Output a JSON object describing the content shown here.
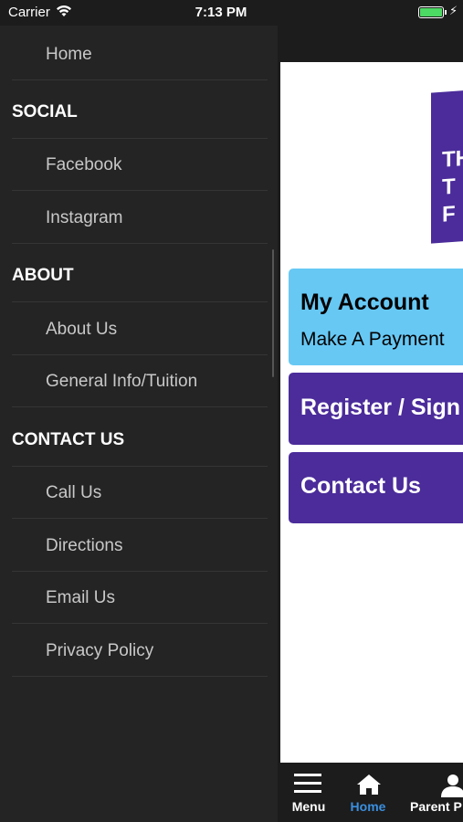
{
  "status_bar": {
    "carrier": "Carrier",
    "time": "7:13 PM",
    "battery_color": "#4cd964"
  },
  "drawer": {
    "items": [
      {
        "type": "item",
        "label": "Home"
      },
      {
        "type": "section",
        "label": "SOCIAL"
      },
      {
        "type": "item",
        "label": "Facebook"
      },
      {
        "type": "item",
        "label": "Instagram"
      },
      {
        "type": "section",
        "label": "ABOUT"
      },
      {
        "type": "item",
        "label": "About Us"
      },
      {
        "type": "item",
        "label": "General Info/Tuition"
      },
      {
        "type": "section",
        "label": "CONTACT US"
      },
      {
        "type": "item",
        "label": "Call Us"
      },
      {
        "type": "item",
        "label": "Directions"
      },
      {
        "type": "item",
        "label": "Email Us"
      },
      {
        "type": "item",
        "label": "Privacy Policy"
      }
    ]
  },
  "main": {
    "logo_text": "TH T F",
    "cards": {
      "account_title": "My Account",
      "account_sub": "Make A Payment",
      "register_title": "Register / Sign",
      "contact_title": "Contact Us"
    },
    "colors": {
      "account_bg": "#67c8f4",
      "brand_purple": "#4b2c9a"
    }
  },
  "tabbar": {
    "menu_label": "Menu",
    "home_label": "Home",
    "parent_label": "Parent P",
    "active_color": "#3a8fe0"
  }
}
